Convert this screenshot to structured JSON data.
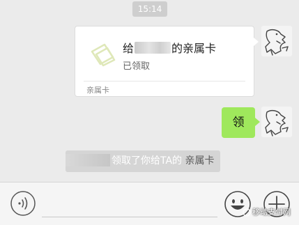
{
  "timestamp": "15:14",
  "card_message": {
    "title_prefix": "给",
    "title_suffix": "的亲属卡",
    "status": "已领取",
    "footer": "亲属卡"
  },
  "text_message": "领",
  "system_notice": {
    "text": "领取了你给TA的",
    "link": "亲属卡"
  },
  "watermark": "移动支付网",
  "icons": {
    "card_icon": "family-card-icon",
    "voice": "voice-icon",
    "emoji": "emoji-icon",
    "plus": "plus-icon"
  },
  "colors": {
    "background": "#ebebeb",
    "bubble_green": "#9fe85c",
    "card_icon": "#dfe8b9"
  }
}
